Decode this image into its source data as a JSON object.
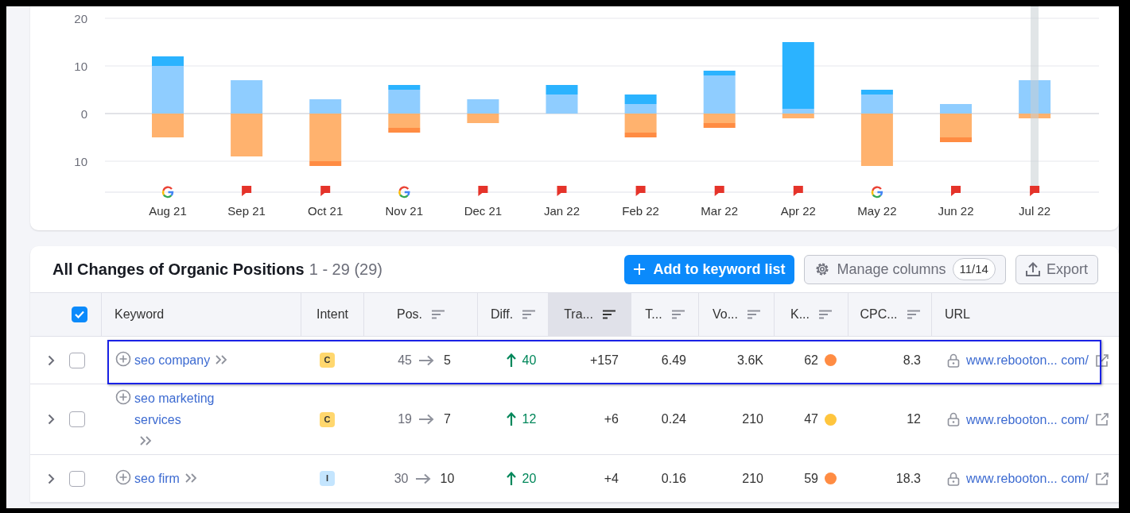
{
  "chart": {
    "chart_data": {
      "type": "bar",
      "stacked": true,
      "categories": [
        "Aug 21",
        "Sep 21",
        "Oct 21",
        "Nov 21",
        "Dec 21",
        "Jan 22",
        "Feb 22",
        "Mar 22",
        "Apr 22",
        "May 22",
        "Jun 22",
        "Jul 22"
      ],
      "ylim": [
        -16.5,
        20
      ],
      "yticks": [
        {
          "value": -10,
          "label": "10"
        },
        0,
        10,
        20
      ],
      "series": [
        {
          "color": "#8fcdff",
          "values": [
            10,
            7,
            3,
            5,
            3,
            4,
            2,
            8,
            1,
            4,
            2,
            7
          ]
        },
        {
          "color": "#2bb3ff",
          "values": [
            2,
            0,
            0,
            1,
            0,
            2,
            2,
            1,
            14,
            1,
            0,
            0
          ]
        },
        {
          "color": "#ffb26e",
          "values": [
            -5,
            -9,
            -10,
            -3,
            -2,
            0,
            -4,
            -2,
            -1,
            -11,
            -5,
            -1
          ]
        },
        {
          "color": "#ff8c43",
          "values": [
            0,
            0,
            -1,
            -1,
            0,
            0,
            -1,
            -1,
            0,
            0,
            -1,
            0
          ]
        }
      ]
    },
    "markers": [
      {
        "kind": "google",
        "selected": false
      },
      {
        "kind": "flag",
        "selected": false
      },
      {
        "kind": "flag",
        "selected": false
      },
      {
        "kind": "google",
        "selected": false
      },
      {
        "kind": "flag",
        "selected": false
      },
      {
        "kind": "flag",
        "selected": false
      },
      {
        "kind": "flag",
        "selected": false
      },
      {
        "kind": "flag",
        "selected": false
      },
      {
        "kind": "flag",
        "selected": false
      },
      {
        "kind": "google",
        "selected": false
      },
      {
        "kind": "flag",
        "selected": false
      },
      {
        "kind": "flag",
        "selected": true
      }
    ]
  },
  "table_card": {
    "title": "All Changes of Organic Positions",
    "range": "1 - 29 (29)",
    "buttons": [
      {
        "kind": "primary",
        "label": "Add to keyword list"
      },
      {
        "kind": "columns",
        "label": "Manage columns",
        "count": "11/14"
      },
      {
        "kind": "export",
        "label": "Export"
      }
    ],
    "select_all": {
      "checked": true
    },
    "columns": [
      {
        "label": "Keyword",
        "sortable": false,
        "sorted": false
      },
      {
        "label": "Intent",
        "sortable": false,
        "sorted": false
      },
      {
        "label": "Pos.",
        "sortable": true,
        "sorted": false
      },
      {
        "label": "Diff.",
        "sortable": true,
        "sorted": false
      },
      {
        "label": "Tra...",
        "sortable": true,
        "sorted": true
      },
      {
        "label": "T...",
        "sortable": true,
        "sorted": false
      },
      {
        "label": "Vo...",
        "sortable": true,
        "sorted": false
      },
      {
        "label": "K...",
        "sortable": true,
        "sorted": false
      },
      {
        "label": "CPC...",
        "sortable": true,
        "sorted": false
      },
      {
        "label": "URL",
        "sortable": false,
        "sorted": false
      }
    ],
    "rows": [
      {
        "checked": false,
        "outlined": true,
        "keyword": "seo company",
        "intent": {
          "label": "C",
          "color": "#ffd76e"
        },
        "pos_from": "45",
        "pos_to": "5",
        "diff": "40",
        "traffic": "+157",
        "t": "6.49",
        "volume": "3.6K",
        "kd": {
          "value": "62",
          "color": "#ff8c43"
        },
        "cpc": "8.3",
        "url": "www.rebooton... com/"
      },
      {
        "checked": false,
        "outlined": false,
        "keyword": "seo marketing services",
        "intent": {
          "label": "C",
          "color": "#ffd76e"
        },
        "pos_from": "19",
        "pos_to": "7",
        "diff": "12",
        "traffic": "+6",
        "t": "0.24",
        "volume": "210",
        "kd": {
          "value": "47",
          "color": "#ffc53d"
        },
        "cpc": "12",
        "url": "www.rebooton... com/"
      },
      {
        "checked": false,
        "outlined": false,
        "keyword": "seo firm",
        "intent": {
          "label": "I",
          "color": "#c4e5fe"
        },
        "pos_from": "30",
        "pos_to": "10",
        "diff": "20",
        "traffic": "+4",
        "t": "0.16",
        "volume": "210",
        "kd": {
          "value": "59",
          "color": "#ff8c43"
        },
        "cpc": "18.3",
        "url": "www.rebooton... com/"
      }
    ]
  }
}
